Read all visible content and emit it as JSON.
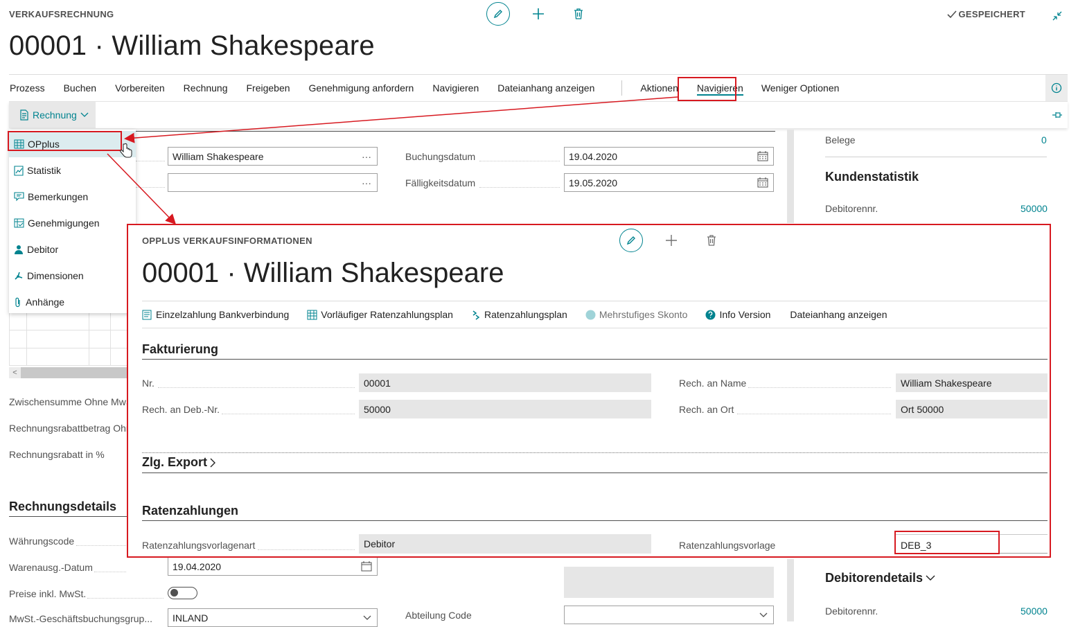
{
  "header": {
    "caption": "VERKAUFSRECHNUNG",
    "title": "00001 · William Shakespeare",
    "saved_label": "GESPEICHERT"
  },
  "actionbar": {
    "items": [
      "Prozess",
      "Buchen",
      "Vorbereiten",
      "Rechnung",
      "Freigeben",
      "Genehmigung anfordern",
      "Navigieren",
      "Dateianhang anzeigen"
    ],
    "aktionen": "Aktionen",
    "navigieren_active": "Navigieren",
    "weniger_optionen": "Weniger Optionen"
  },
  "subbar": {
    "rechnung": "Rechnung"
  },
  "dropdown": {
    "items": [
      "OPplus",
      "Statistik",
      "Bemerkungen",
      "Genehmigungen",
      "Debitor",
      "Dimensionen",
      "Anhänge"
    ]
  },
  "form": {
    "customer_name": "William Shakespeare",
    "buchungsdatum_label": "Buchungsdatum",
    "buchungsdatum": "19.04.2020",
    "faelligkeitsdatum_label": "Fälligkeitsdatum",
    "faelligkeitsdatum": "19.05.2020",
    "zwischensumme_label": "Zwischensumme Ohne MwSt.",
    "rechnungsrabattbetrag_label": "Rechnungsrabattbetrag Ohne",
    "rechnungsrabatt_label": "Rechnungsrabatt in %",
    "rechnungsdetails_heading": "Rechnungsdetails",
    "waehrungscode_label": "Währungscode",
    "warenausg_label": "Warenausg.-Datum",
    "warenausg_value": "19.04.2020",
    "preise_inkl_label": "Preise inkl. MwSt.",
    "mwst_label": "MwSt.-Geschäftsbuchungsgrup...",
    "mwst_value": "INLAND",
    "abteilung_label": "Abteilung Code"
  },
  "factbox": {
    "belege_label": "Belege",
    "belege_value": "0",
    "kundenstatistik_heading": "Kundenstatistik",
    "debitorennr_label": "Debitorennr.",
    "debitorennr_value": "50000",
    "debitorendetails_heading": "Debitorendetails",
    "debitorennr2_label": "Debitorennr.",
    "debitorennr2_value": "50000"
  },
  "dialog": {
    "caption": "OPPLUS VERKAUFSINFORMATIONEN",
    "title": "00001 · William Shakespeare",
    "actions": {
      "einzelzahlung": "Einzelzahlung Bankverbindung",
      "vorlaeufiger": "Vorläufiger Ratenzahlungsplan",
      "ratenzahlungsplan": "Ratenzahlungsplan",
      "mehrstufiges": "Mehrstufiges Skonto",
      "info_version": "Info Version",
      "dateianhang": "Dateianhang anzeigen"
    },
    "fakturierung_heading": "Fakturierung",
    "nr_label": "Nr.",
    "nr_value": "00001",
    "rech_deb_label": "Rech. an Deb.-Nr.",
    "rech_deb_value": "50000",
    "rech_name_label": "Rech. an Name",
    "rech_name_value": "William Shakespeare",
    "rech_ort_label": "Rech. an Ort",
    "rech_ort_value": "Ort 50000",
    "zlg_export_heading": "Zlg. Export",
    "ratenzahlungen_heading": "Ratenzahlungen",
    "vorlagenart_label": "Ratenzahlungsvorlagenart",
    "vorlagenart_value": "Debitor",
    "vorlage_label": "Ratenzahlungsvorlage",
    "vorlage_value": "DEB_3"
  },
  "colors": {
    "accent": "#00838f",
    "highlight": "#d71920"
  }
}
